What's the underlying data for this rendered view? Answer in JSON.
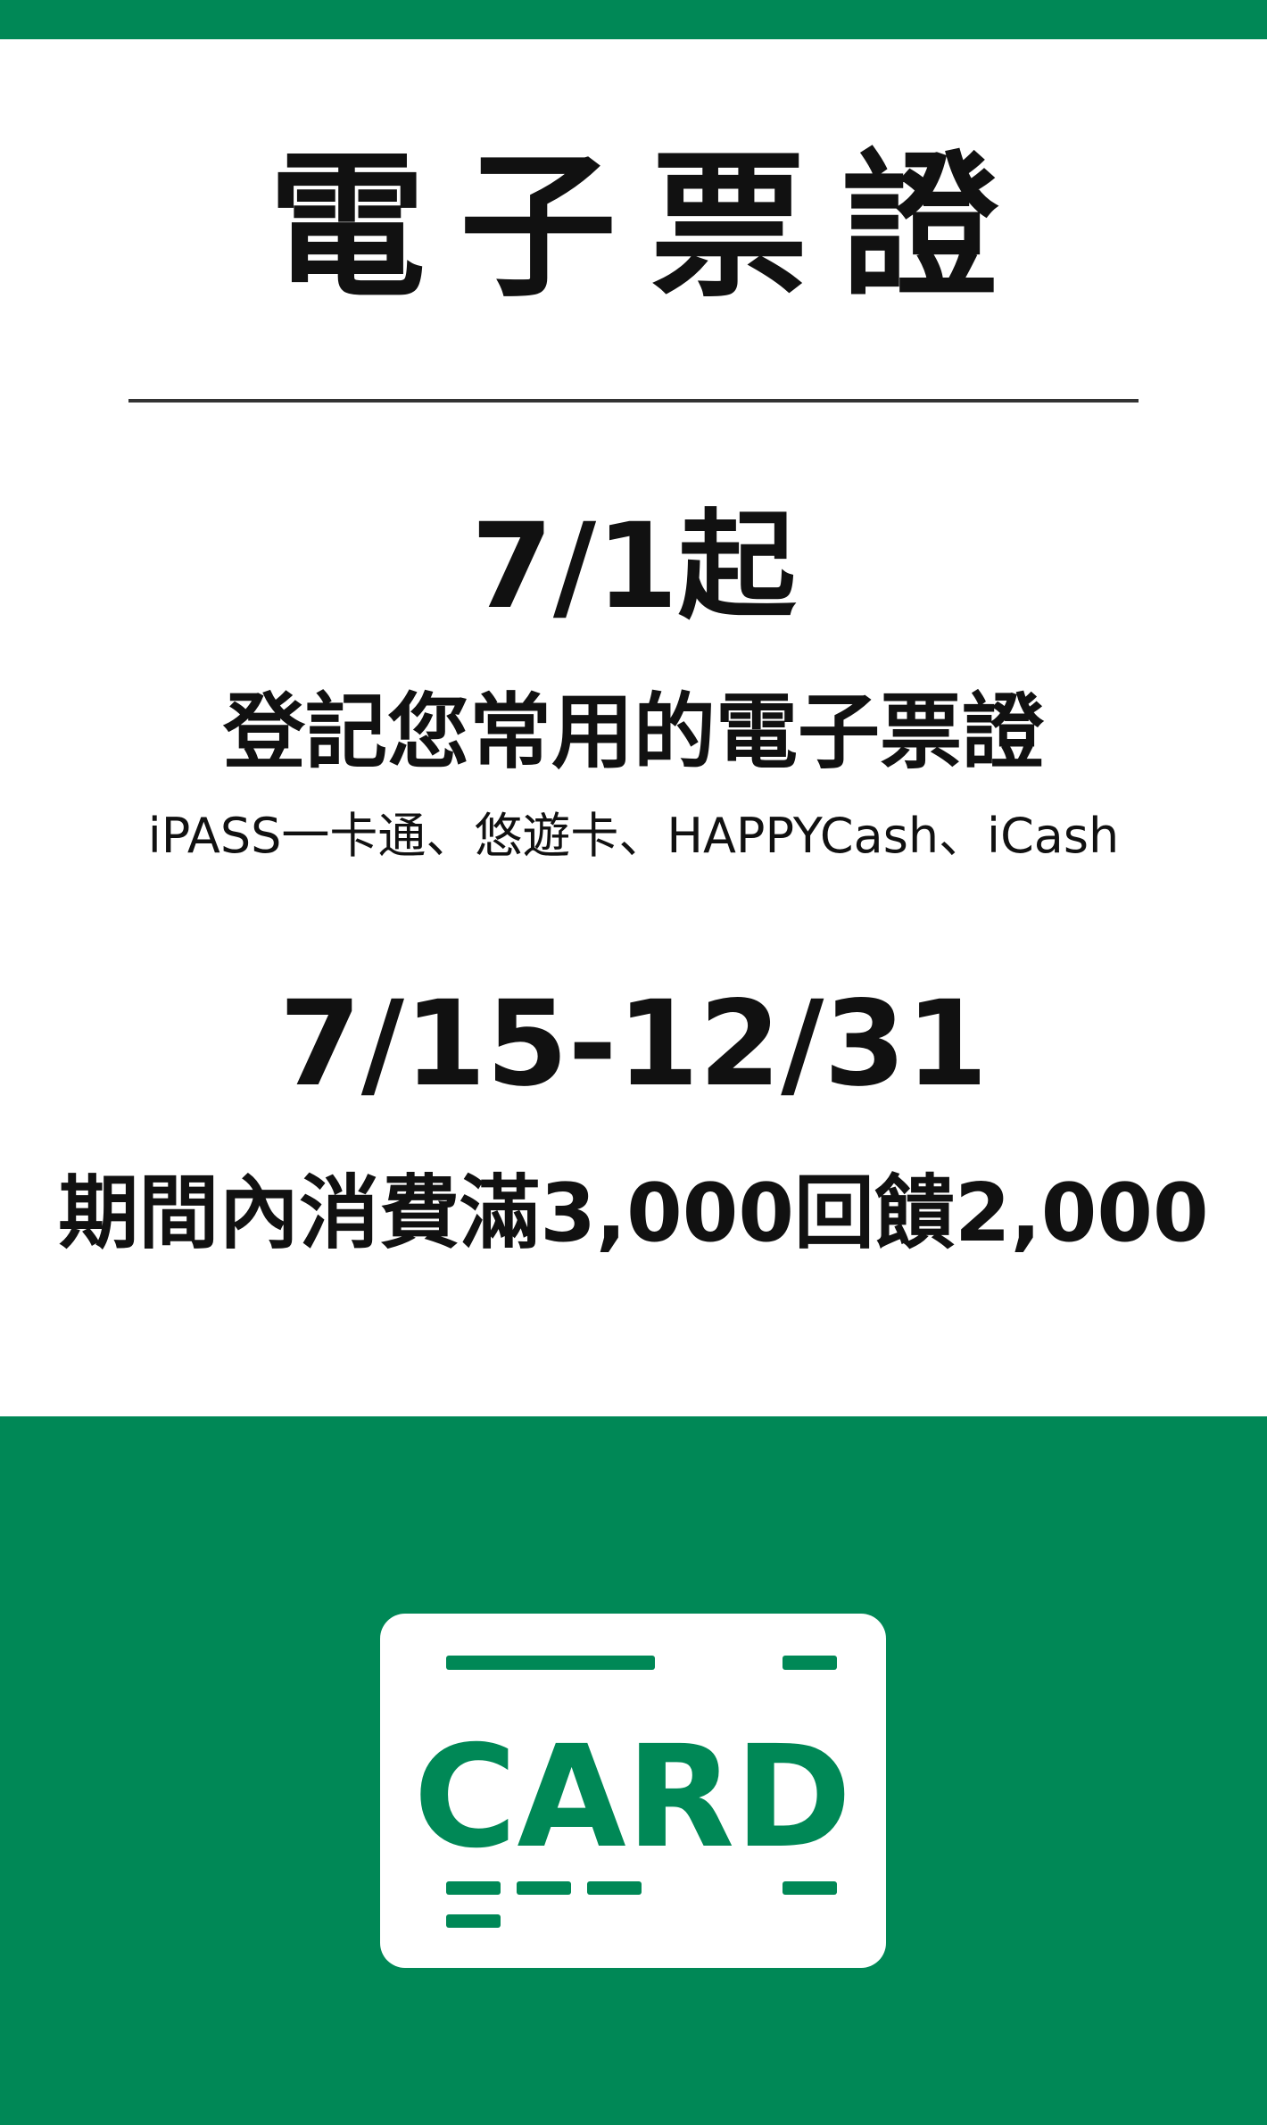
{
  "title": "電子票證",
  "date_start": "7/1起",
  "register_text": "登記您常用的電子票證",
  "cards_text": "iPASS一卡通、悠遊卡、HAPPYCash、iCash",
  "date_range": "7/15-12/31",
  "reward_text": "期間內消費滿3,000回饋2,000",
  "card_icon": {
    "name": "card-icon",
    "label": "CARD"
  },
  "colors": {
    "brand_green": "#008856",
    "text": "#111111",
    "background": "#ffffff",
    "divider": "#333333"
  }
}
